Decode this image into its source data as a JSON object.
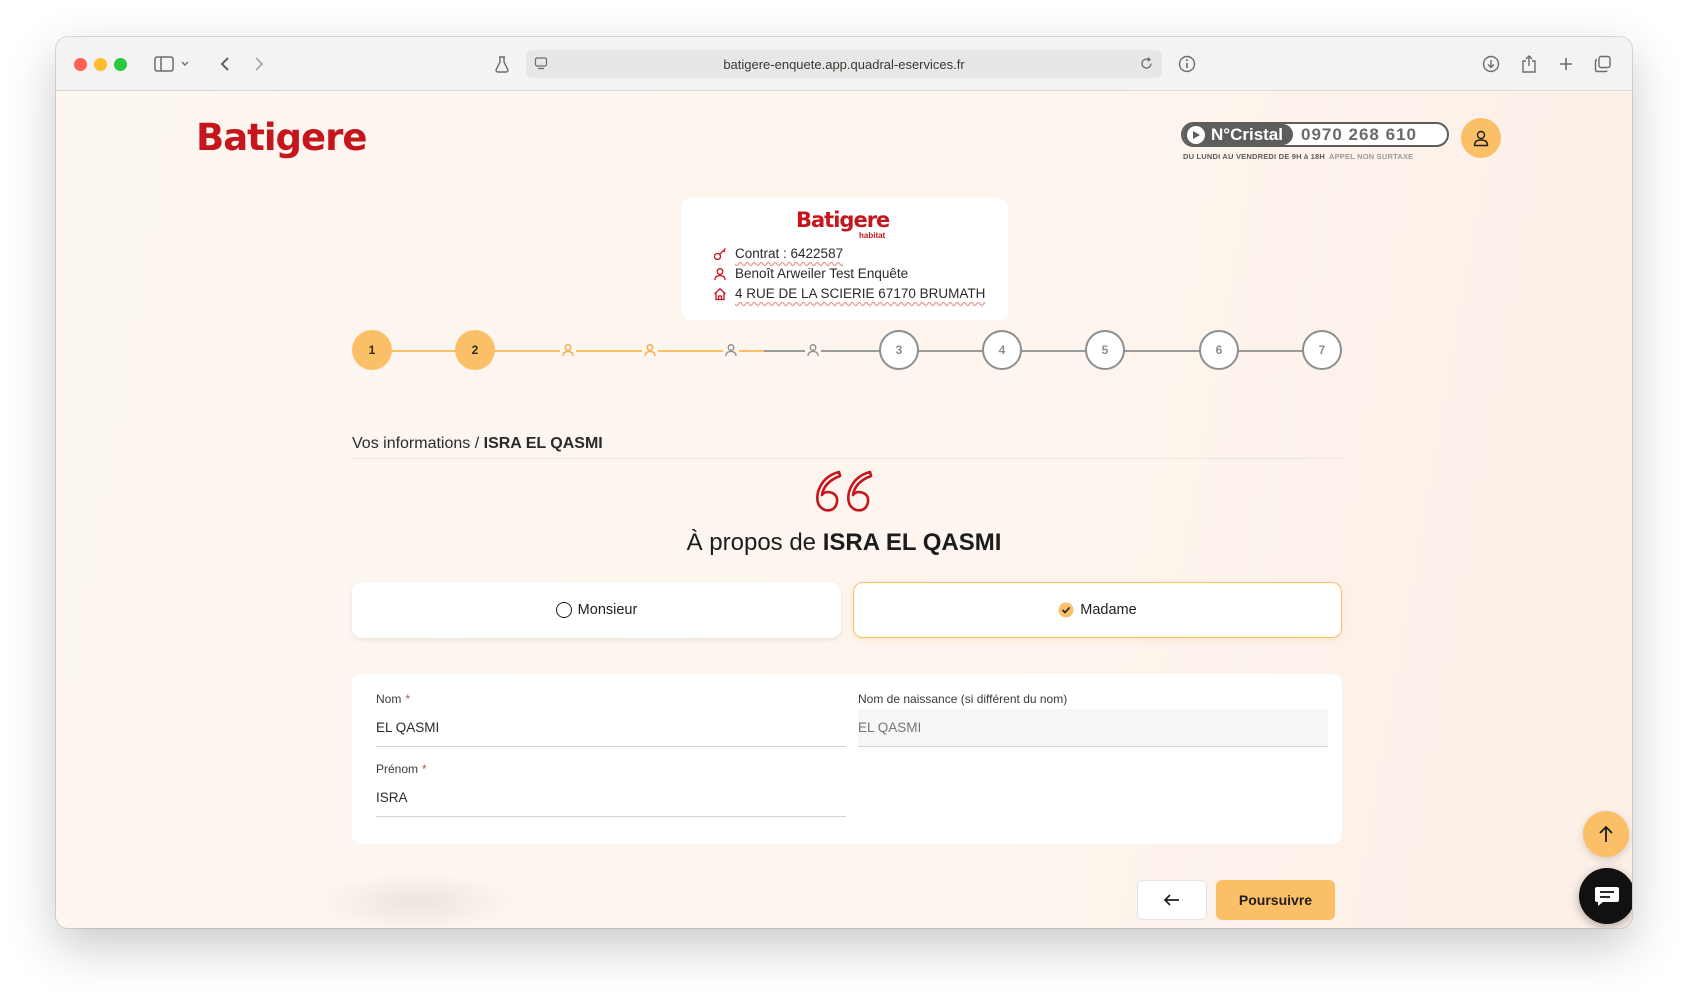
{
  "browser": {
    "url": "batigere-enquete.app.quadral-eservices.fr"
  },
  "header": {
    "logo_text": "Batigere",
    "cristal_label": "N°Cristal",
    "cristal_number": "0970 268 610",
    "cristal_hours": "DU LUNDI AU VENDREDI DE 9H à 18H",
    "cristal_note": "APPEL NON SURTAXE"
  },
  "contract": {
    "logo_text": "Batigere",
    "logo_sub": "habitat",
    "contract_label": "Contrat : 6422587",
    "name": "Benoît Arweiler Test Enquête",
    "address": "4 RUE DE LA SCIERIE 67170 BRUMATH"
  },
  "stepper": {
    "steps": [
      "1",
      "2",
      "3",
      "4",
      "5",
      "6",
      "7"
    ]
  },
  "breadcrumb": {
    "section": "Vos informations",
    "separator": " / ",
    "person": "ISRA EL QASMI"
  },
  "heading": {
    "prefix": "À propos de ",
    "person": "ISRA EL QASMI"
  },
  "gender": {
    "options": [
      {
        "label": "Monsieur",
        "selected": false
      },
      {
        "label": "Madame",
        "selected": true
      }
    ]
  },
  "form": {
    "nom_label": "Nom",
    "nom_value": "EL QASMI",
    "naissance_label": "Nom de naissance (si différent du nom)",
    "naissance_placeholder": "EL QASMI",
    "prenom_label": "Prénom",
    "prenom_value": "ISRA",
    "required_mark": "*"
  },
  "actions": {
    "next_label": "Poursuivre"
  },
  "colors": {
    "brand_red": "#c4161c",
    "accent_orange": "#fbbf67"
  }
}
